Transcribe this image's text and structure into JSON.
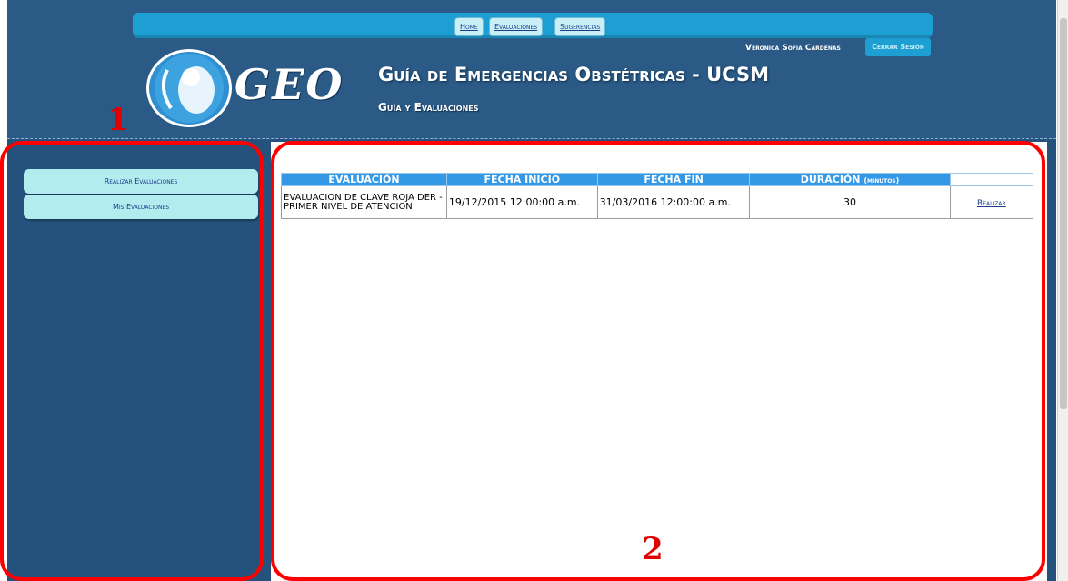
{
  "nav": {
    "home": "Home",
    "evaluaciones": "Evaluaciones",
    "sugerencias": "Sugerencias"
  },
  "user": {
    "name": "Veronica Sofia Cardenas",
    "logout": "Cerrar Sesión"
  },
  "brand": {
    "logo_text": "GEO",
    "title": "Guía de Emergencias Obstétricas - UCSM",
    "subtitle": "Guía y Evaluaciones"
  },
  "sidebar": {
    "items": [
      {
        "label": "Realizar Evaluaciones"
      },
      {
        "label": "Mis Evaluaciones"
      }
    ]
  },
  "table": {
    "headers": {
      "evaluacion": "EVALUACIÓN",
      "fecha_inicio": "FECHA INICIO",
      "fecha_fin": "FECHA FIN",
      "duracion": "DURACIÓN",
      "duracion_unit": "(minutos)"
    },
    "rows": [
      {
        "evaluacion": "EVALUACION DE CLAVE ROJA DER - PRIMER NIVEL DE ATENCION",
        "fecha_inicio": "19/12/2015 12:00:00 a.m.",
        "fecha_fin": "31/03/2016 12:00:00 a.m.",
        "duracion": "30",
        "action": "Realizar"
      }
    ]
  },
  "annotations": {
    "left": "1",
    "right": "2"
  },
  "colors": {
    "background": "#24527c",
    "accent": "#1e9fd4",
    "annotation": "#ff0000"
  }
}
